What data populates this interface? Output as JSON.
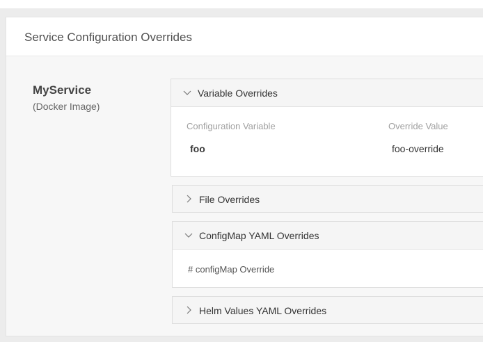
{
  "panel": {
    "title": "Service Configuration Overrides"
  },
  "service": {
    "name": "MyService",
    "type": "(Docker Image)"
  },
  "sections": {
    "variable_overrides": {
      "title": "Variable Overrides",
      "expanded": true,
      "columns": [
        "Configuration Variable",
        "Override Value"
      ],
      "rows": [
        {
          "variable": "foo",
          "value": "foo-override"
        }
      ]
    },
    "file_overrides": {
      "title": "File Overrides",
      "expanded": false
    },
    "configmap_overrides": {
      "title": "ConfigMap YAML Overrides",
      "expanded": true,
      "content": "# configMap Override"
    },
    "helm_overrides": {
      "title": "Helm Values YAML Overrides",
      "expanded": false
    }
  },
  "icons": {
    "expanded": "chevron-down-icon",
    "collapsed": "chevron-right-icon"
  }
}
